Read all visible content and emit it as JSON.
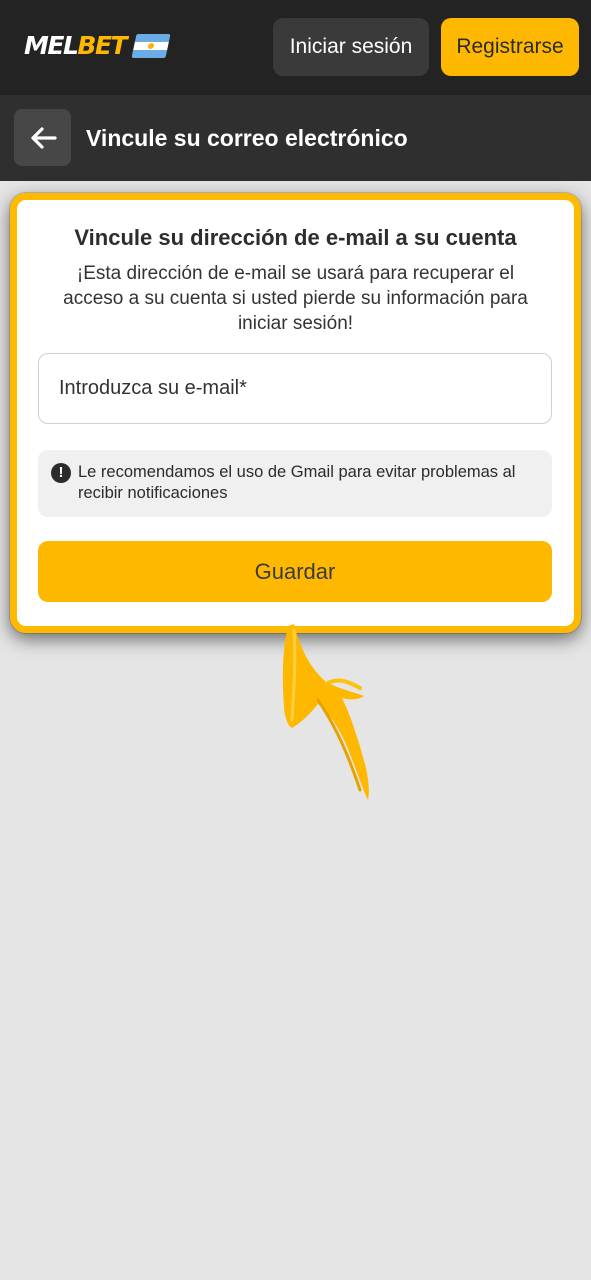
{
  "header": {
    "logo_part1": "MEL",
    "logo_part2": "BET",
    "flag_icon": "argentina-flag-icon",
    "login_label": "Iniciar sesión",
    "register_label": "Registrarse"
  },
  "subheader": {
    "back_icon": "arrow-left-icon",
    "title": "Vincule su correo electrónico"
  },
  "card": {
    "title": "Vincule su dirección de e-mail a su cuenta",
    "description": "¡Esta dirección de e-mail se usará para recuperar el acceso a su cuenta si usted pierde su información para iniciar sesión!",
    "email_placeholder": "Introduzca su e-mail*",
    "email_value": "",
    "notice_icon": "exclamation-circle-icon",
    "notice_text": "Le recomendamos el uso de Gmail para evitar problemas al recibir notificaciones",
    "save_label": "Guardar"
  },
  "annotation": {
    "arrow_icon": "hand-drawn-arrow-up-icon"
  },
  "colors": {
    "accent": "#ffb800",
    "header_bg": "#232323",
    "subheader_bg": "#2f2f2f",
    "page_bg": "#e5e5e5",
    "card_border": "#ffba00"
  }
}
